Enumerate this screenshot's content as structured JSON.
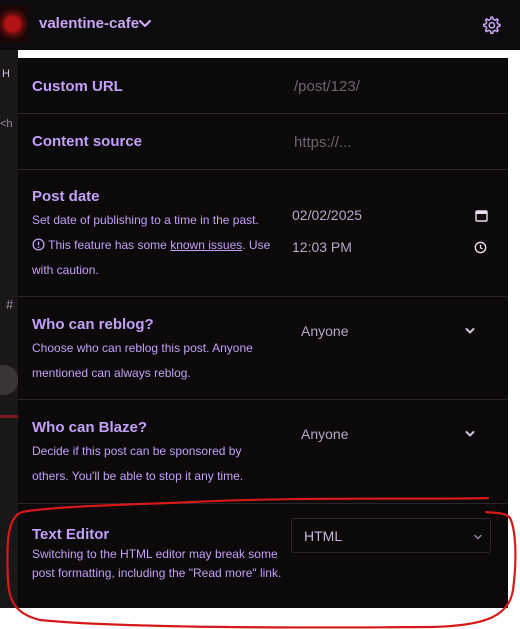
{
  "header": {
    "blog_name": "valentine-cafe",
    "avatar_icon": "avatar-image",
    "dropdown_icon": "chevron-down-icon",
    "settings_icon": "gear-icon"
  },
  "background_fragments": {
    "first": "H",
    "second": "<h",
    "third": "#"
  },
  "settings": {
    "custom_url": {
      "label": "Custom URL",
      "placeholder": "/post/123/"
    },
    "content_source": {
      "label": "Content source",
      "placeholder": "https://..."
    },
    "post_date": {
      "label": "Post date",
      "description": "Set date of publishing to a time in the past.",
      "warning_prefix": "This feature has some",
      "warning_link": "known issues",
      "warning_suffix": ". Use with caution.",
      "date_value": "02/02/2025",
      "time_value": "12:03 PM"
    },
    "who_can_reblog": {
      "label": "Who can reblog?",
      "description": "Choose who can reblog this post. Anyone mentioned can always reblog.",
      "value": "Anyone"
    },
    "who_can_blaze": {
      "label": "Who can Blaze?",
      "description": "Decide if this post can be sponsored by others. You'll be able to stop it any time.",
      "value": "Anyone"
    },
    "text_editor": {
      "label": "Text Editor",
      "description": "Switching to the HTML editor may break some post formatting, including the \"Read more\" link.",
      "value": "HTML"
    }
  },
  "colors": {
    "accent": "#c3a1f8",
    "panel_background": "#0b090a",
    "annotation": "#d51919"
  }
}
